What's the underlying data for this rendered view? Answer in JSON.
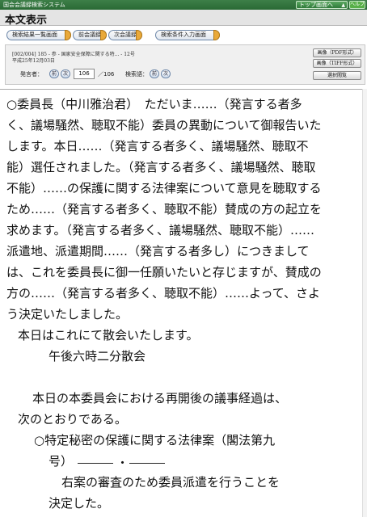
{
  "topbar": {
    "system_name": "国会会議録検索システム",
    "top_button_label": "トップ画面へ",
    "help_button_label": "ヘルプ"
  },
  "titlebar": {
    "title": "本文表示"
  },
  "nav": {
    "results_list": "検索結果一覧画面",
    "prev_meeting": "前会議録",
    "next_meeting": "次会議録",
    "search_input": "検索条件入力画面"
  },
  "info": {
    "doc_line": "[002/004] 185 - 参 - 国家安全保障に関する特... - 12号",
    "date_line": "平成25年12月03日",
    "speaker_label": "発言者：",
    "prev": "前",
    "next": "次",
    "speaker_number": "106",
    "speaker_total": "／106",
    "search_term_label": "検索語：",
    "pdf_button": "画像（PDF形式）",
    "tiff_button": "画像（TIFF形式）",
    "select_view_button": "選択閲覧"
  },
  "content": {
    "lines": [
      "○委員長（中川雅治君）　ただいま……（発言する者多",
      "く、議場騒然、聴取不能）委員の異動について御報告いた",
      "します。本日……（発言する者多く、議場騒然、聴取不",
      "能）選任されました。（発言する者多く、議場騒然、聴取",
      "不能）……の保護に関する法律案について意見を聴取する",
      "ため……（発言する者多く、聴取不能）賛成の方の起立を",
      "求めます。（発言する者多く、議場騒然、聴取不能）……",
      "派遣地、派遣期間……（発言する者多し）につきまして",
      "は、これを委員長に御一任願いたいと存じますが、賛成の",
      "方の……（発言する者多く、聴取不能）……よって、さよ",
      "う決定いたしました。",
      "本日はこれにて散会いたします。",
      "午後六時二分散会",
      "・",
      "本日の本委員会における再開後の議事経過は、",
      "次のとおりである。",
      "○特定秘密の保護に関する法律案（閣法第九",
      "号）",
      "右案の審査のため委員派遣を行うことを",
      "決定した。"
    ]
  },
  "colors": {
    "topbar": "#2a6a35",
    "accent_pill": "#e9a93a"
  }
}
